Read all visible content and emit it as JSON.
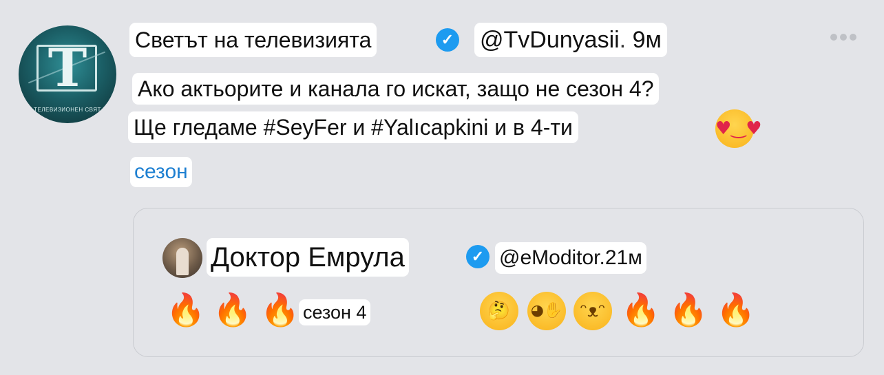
{
  "tweet": {
    "author_name": "Светът на телевизията",
    "handle": "@TvDunyasii",
    "separator": ".",
    "time": "9м",
    "text_line1": "Ако актьорите и канала го искат, защо не сезон 4?",
    "text_line2": "Ще гледаме #SeyFer и #Yalıcapkini и в 4-ти",
    "text_line3": "сезон",
    "avatar_text": "ТЕЛЕВИЗИОНЕН СВЯТ"
  },
  "quote": {
    "author_name": "Доктор Емрула",
    "handle_time": "@eModitor.21м",
    "text": "сезон 4"
  },
  "icons": {
    "verified": "verified-badge-icon",
    "more": "more-options-icon",
    "heart_eyes": "smiling-face-with-heart-eyes-emoji",
    "fire": "fire-emoji",
    "thinking": "thinking-face-emoji",
    "hand_over_mouth": "face-with-hand-over-mouth-emoji",
    "grin": "grinning-face-emoji"
  },
  "colors": {
    "background": "#e3e4e8",
    "verified": "#1d9bf0",
    "link": "#1d7fd1"
  }
}
